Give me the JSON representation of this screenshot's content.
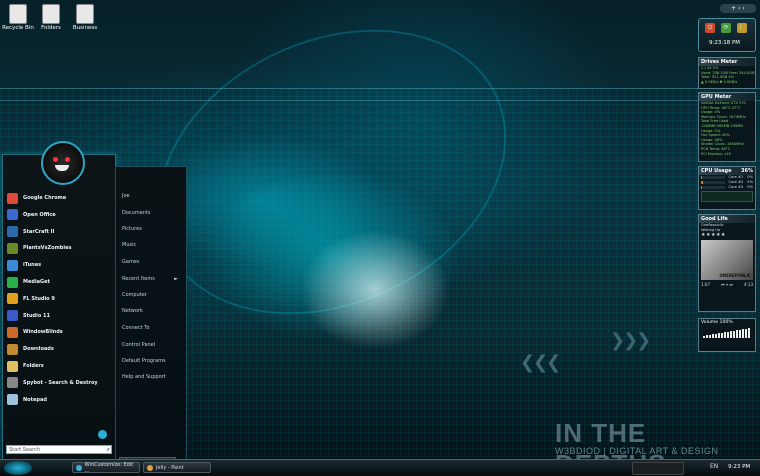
{
  "desktop_icons": [
    {
      "label": "Recycle Bin",
      "icon": "recycle-bin-icon"
    },
    {
      "label": "Folders",
      "icon": "folder-icon"
    },
    {
      "label": "Business",
      "icon": "folder-icon"
    }
  ],
  "wallpaper": {
    "title": "IN THE DEPTHS",
    "credit": "W3BDIOD | DIGITAL ART & DESIGN"
  },
  "start_menu": {
    "programs": [
      {
        "label": "Google Chrome",
        "color": "#e04a3a"
      },
      {
        "label": "Open Office",
        "color": "#3a6ad0"
      },
      {
        "label": "StarCraft II",
        "color": "#2a6aa8"
      },
      {
        "label": "PlantsVsZombies",
        "color": "#6a8a2a"
      },
      {
        "label": "iTunes",
        "color": "#3a8ad8"
      },
      {
        "label": "MediaGet",
        "color": "#2ab04a"
      },
      {
        "label": "FL Studio 9",
        "color": "#e0a020"
      },
      {
        "label": "Studio 11",
        "color": "#3a5ac8"
      },
      {
        "label": "WindowBlinds",
        "color": "#d06a2a"
      },
      {
        "label": "Downloads",
        "color": "#c08a30"
      },
      {
        "label": "Folders",
        "color": "#e0c060"
      },
      {
        "label": "Spybot - Search & Destroy",
        "color": "#888888"
      },
      {
        "label": "Notepad",
        "color": "#a0c0e0"
      }
    ],
    "right_links": [
      {
        "label": "Joe",
        "arrow": ""
      },
      {
        "label": "Documents",
        "arrow": ""
      },
      {
        "label": "Pictures",
        "arrow": ""
      },
      {
        "label": "Music",
        "arrow": ""
      },
      {
        "label": "Games",
        "arrow": ""
      },
      {
        "label": "Recent Items",
        "arrow": "►"
      },
      {
        "label": "Computer",
        "arrow": ""
      },
      {
        "label": "Network",
        "arrow": ""
      },
      {
        "label": "Connect To",
        "arrow": ""
      },
      {
        "label": "Control Panel",
        "arrow": ""
      },
      {
        "label": "Default Programs",
        "arrow": ""
      },
      {
        "label": "Help and Support",
        "arrow": ""
      }
    ],
    "search_placeholder": "Start Search",
    "power_arrow": "►"
  },
  "taskbar": {
    "tasks": [
      {
        "label": "WinCustomize: Edit ...",
        "color": "#3ab0e0"
      },
      {
        "label": "Jelly - Paint",
        "color": "#e0a040"
      }
    ],
    "language": "EN",
    "clock": "9:23 PM"
  },
  "gadgets": {
    "clock_time": "9:23:18 PM",
    "drives": {
      "title": "Drives Meter",
      "lines": [
        "C:\\ All                    0%",
        "Used: 338.1GB    Free: 244.0GB",
        "Total: 521.9GB    4%",
        "▲ 0.0KB/s        ▼ 0.0KB/s"
      ]
    },
    "gpu": {
      "title": "GPU Meter",
      "lines": [
        "NVIDIA GeForce GTX 570",
        "GPU Temp: 46°C       47°C",
        "Usage: 0%",
        "Memory Clock: 1674MHz",
        "  Total      Free      Used",
        "1280MB  985MB  295MB",
        "Usage: 0%",
        "Fan Speed: 40%",
        "Usage: 46%",
        "Shader Clock: 1464MHz",
        "PCB Temp: 46°C",
        "PCI Express: x16"
      ]
    },
    "cpu": {
      "title": "CPU Usage",
      "percent": "36%",
      "cores": [
        {
          "label": "Core #1",
          "value": "0%",
          "fill": 0.05
        },
        {
          "label": "Core #2",
          "value": "4%",
          "fill": 0.1
        },
        {
          "label": "Core #3",
          "value": "0%",
          "fill": 0.05
        }
      ]
    },
    "media": {
      "title": "Good Life",
      "artist": "OneRepublic",
      "album": "Waking Up",
      "album_art_text": "ONEREPUBLIC",
      "elapsed": "1:07",
      "remaining": "4:13",
      "stars": "★★★★★"
    },
    "volume": {
      "label": "Volume 100%",
      "level": 1.0
    }
  }
}
